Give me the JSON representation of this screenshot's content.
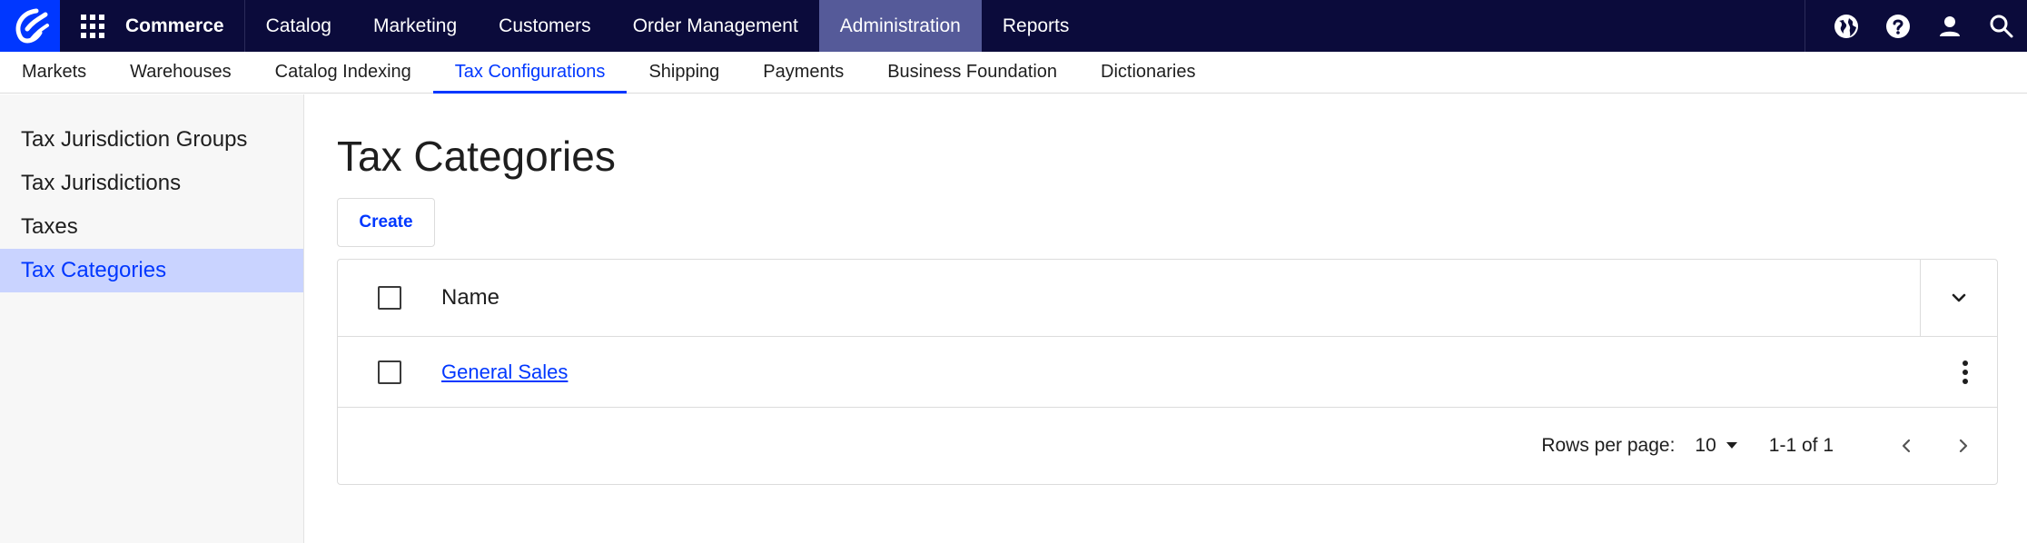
{
  "topbar": {
    "brand": "Commerce",
    "nav": [
      "Catalog",
      "Marketing",
      "Customers",
      "Order Management",
      "Administration",
      "Reports"
    ],
    "active": "Administration",
    "icons": [
      "globe-icon",
      "help-icon",
      "user-icon",
      "search-icon"
    ]
  },
  "subnav": {
    "items": [
      "Markets",
      "Warehouses",
      "Catalog Indexing",
      "Tax Configurations",
      "Shipping",
      "Payments",
      "Business Foundation",
      "Dictionaries"
    ],
    "active": "Tax Configurations"
  },
  "sidebar": {
    "items": [
      "Tax Jurisdiction Groups",
      "Tax Jurisdictions",
      "Taxes",
      "Tax Categories"
    ],
    "active": "Tax Categories"
  },
  "main": {
    "title": "Tax Categories",
    "create_label": "Create",
    "table": {
      "columns": [
        "Name"
      ],
      "rows": [
        {
          "name": "General Sales"
        }
      ]
    },
    "pagination": {
      "rows_per_page_label": "Rows per page:",
      "rows_per_page_value": "10",
      "range": "1-1 of 1"
    }
  },
  "colors": {
    "topbar_bg": "#0b0b3b",
    "accent": "#0037ff",
    "active_nav_bg": "#555a99",
    "sidebar_active_bg": "#c9d3ff"
  }
}
